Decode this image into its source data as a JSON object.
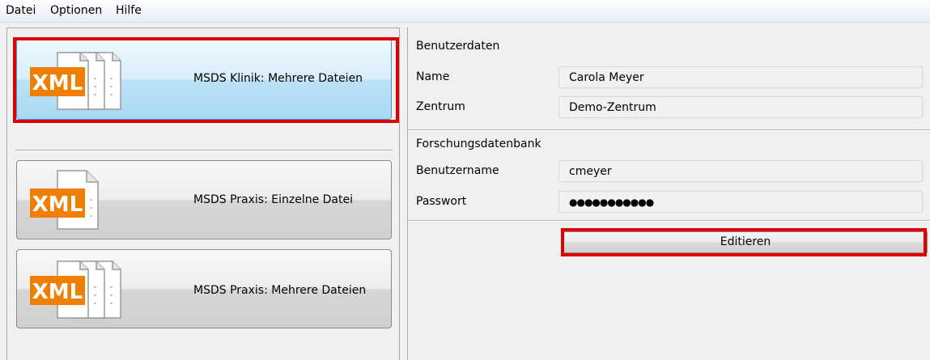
{
  "menu": {
    "items": [
      "Datei",
      "Optionen",
      "Hilfe"
    ]
  },
  "import_tiles": [
    {
      "label": "MSDS Klinik: Mehrere Dateien",
      "icon": "xml-files-icon",
      "selected": true
    },
    {
      "label": "MSDS Praxis: Einzelne Datei",
      "icon": "xml-file-icon",
      "selected": false
    },
    {
      "label": "MSDS Praxis: Mehrere Dateien",
      "icon": "xml-files-icon",
      "selected": false
    }
  ],
  "icon_text": "XML",
  "user_data": {
    "title": "Benutzerdaten",
    "name_label": "Name",
    "name_value": "Carola Meyer",
    "center_label": "Zentrum",
    "center_value": "Demo-Zentrum"
  },
  "research_db": {
    "title": "Forschungsdatenbank",
    "username_label": "Benutzername",
    "username_value": "cmeyer",
    "password_label": "Passwort",
    "password_value": "●●●●●●●●●●●"
  },
  "edit_button": {
    "label": "Editieren"
  },
  "colors": {
    "xml_orange": "#f07f00",
    "highlight_red": "#e00000",
    "selected_border": "#3c9ad1"
  }
}
